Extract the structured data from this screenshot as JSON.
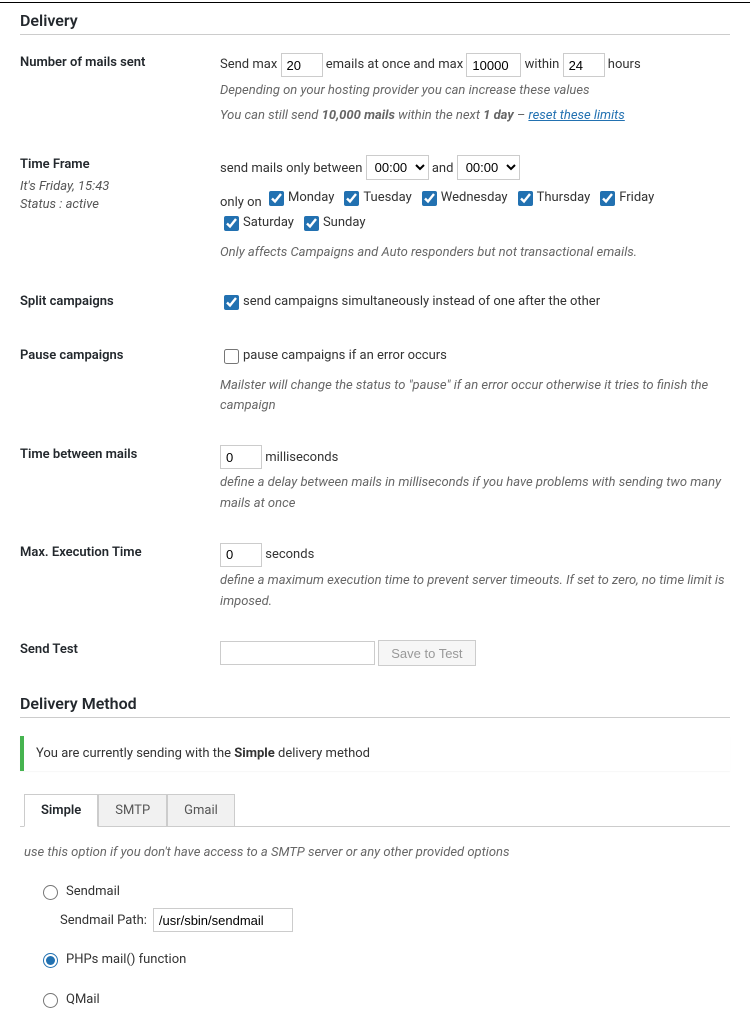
{
  "sections": {
    "delivery_title": "Delivery",
    "delivery_method_title": "Delivery Method"
  },
  "mails_sent": {
    "label": "Number of mails sent",
    "pre1": "Send max",
    "val1": "20",
    "mid1": "emails at once and max",
    "val2": "10000",
    "mid2": "within",
    "val3": "24",
    "post": "hours",
    "hint1": "Depending on your hosting provider you can increase these values",
    "hint2_pre": "You can still send ",
    "hint2_bold1": "10,000 mails",
    "hint2_mid": " within the next ",
    "hint2_bold2": "1 day",
    "hint2_sep": " – ",
    "hint2_link": "reset these limits"
  },
  "timeframe": {
    "label": "Time Frame",
    "sub1": "It's Friday, 15:43",
    "sub2": "Status : active",
    "pre": "send mails only between",
    "from": "00:00",
    "and": "and",
    "to": "00:00",
    "onlyon": "only on",
    "days": [
      "Monday",
      "Tuesday",
      "Wednesday",
      "Thursday",
      "Friday",
      "Saturday",
      "Sunday"
    ],
    "hint": "Only affects Campaigns and Auto responders but not transactional emails."
  },
  "split": {
    "label": "Split campaigns",
    "text": "send campaigns simultaneously instead of one after the other"
  },
  "pause": {
    "label": "Pause campaigns",
    "text": "pause campaigns if an error occurs",
    "hint": "Mailster will change the status to \"pause\" if an error occur otherwise it tries to finish the campaign"
  },
  "between": {
    "label": "Time between mails",
    "val": "0",
    "unit": "milliseconds",
    "hint": "define a delay between mails in milliseconds if you have problems with sending two many mails at once"
  },
  "maxexec": {
    "label": "Max. Execution Time",
    "val": "0",
    "unit": "seconds",
    "hint": "define a maximum execution time to prevent server timeouts. If set to zero, no time limit is imposed."
  },
  "sendtest": {
    "label": "Send Test",
    "btn": "Save to Test"
  },
  "notice": {
    "pre": "You are currently sending with the ",
    "bold": "Simple",
    "post": " delivery method"
  },
  "tabs": [
    "Simple",
    "SMTP",
    "Gmail"
  ],
  "tab_content": {
    "desc": "use this option if you don't have access to a SMTP server or any other provided options",
    "opt_sendmail": "Sendmail",
    "sendmail_path_label": "Sendmail Path:",
    "sendmail_path": "/usr/sbin/sendmail",
    "opt_php": "PHPs mail() function",
    "opt_qmail": "QMail"
  }
}
